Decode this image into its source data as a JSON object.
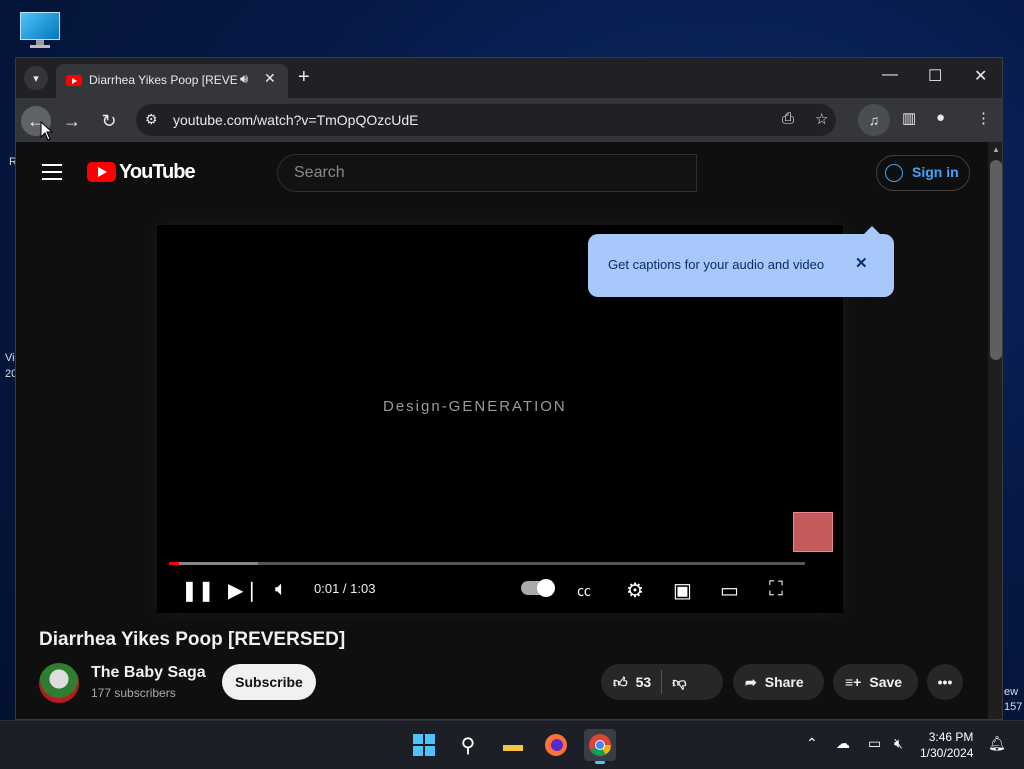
{
  "desktop": {
    "fragments": [
      "R",
      "Vi",
      "20",
      "ew",
      "157"
    ]
  },
  "browser": {
    "tab": {
      "title": "Diarrhea Yikes Poop [REVERSED]",
      "close": "✕"
    },
    "new_tab": "+",
    "window_controls": {
      "minimize": "—",
      "maximize": "☐",
      "close": "✕"
    },
    "url": "youtube.com/watch?v=TmOpQOzcUdE"
  },
  "youtube": {
    "logo_text": "YouTube",
    "search_placeholder": "Search",
    "sign_in": "Sign in",
    "tooltip": "Get captions for your audio and video",
    "player": {
      "overlay_text": "Design-GENERATION",
      "time": "0:01 / 1:03",
      "progress_fraction": 0.016,
      "buffer_fraction": 0.14
    },
    "video_title": "Diarrhea Yikes Poop [REVERSED]",
    "channel_name": "The Baby Saga",
    "subscribers": "177 subscribers",
    "subscribe": "Subscribe",
    "likes": "53",
    "share": "Share",
    "save": "Save"
  },
  "taskbar": {
    "time": "3:46 PM",
    "date": "1/30/2024"
  }
}
